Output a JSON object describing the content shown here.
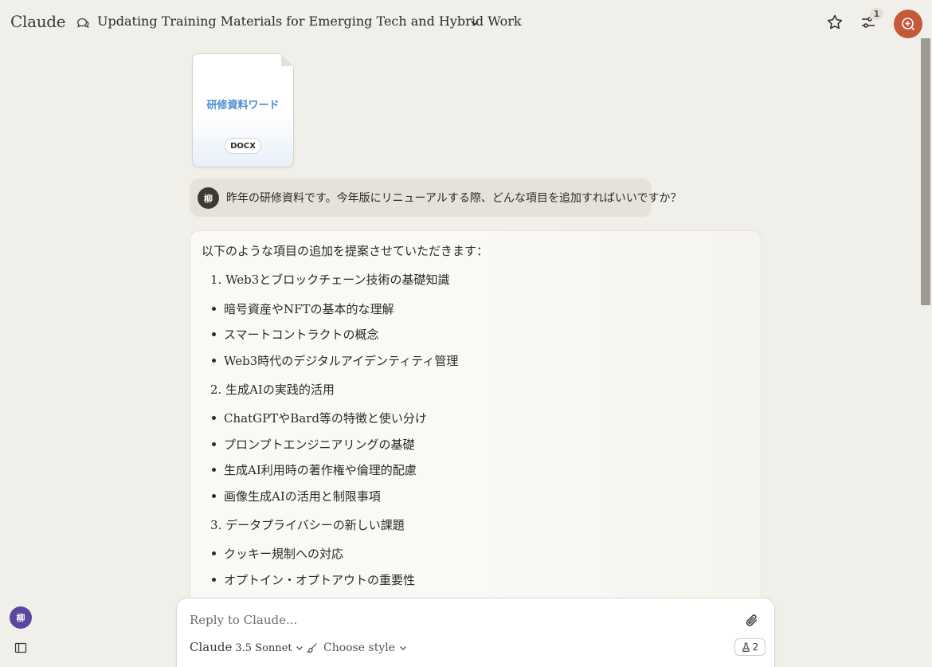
{
  "app": {
    "name": "Claude"
  },
  "header": {
    "chat_title": "Updating Training Materials for Emerging Tech and Hybrid Work",
    "settings_badge": "1"
  },
  "attachment": {
    "name": "研修資料ワード",
    "type": "DOCX"
  },
  "user_message": {
    "avatar_initial": "柳",
    "text": "昨年の研修資料です。今年版にリニューアルする際、どんな項目を追加すればいいですか？"
  },
  "assistant_message": {
    "intro": "以下のような項目の追加を提案させていただきます：",
    "lines": [
      {
        "kind": "numbered",
        "text": "1. Web3とブロックチェーン技術の基礎知識"
      },
      {
        "kind": "bullet",
        "text": "暗号資産やNFTの基本的な理解"
      },
      {
        "kind": "bullet",
        "text": "スマートコントラクトの概念"
      },
      {
        "kind": "bullet",
        "text": "Web3時代のデジタルアイデンティティ管理"
      },
      {
        "kind": "numbered",
        "text": "2. 生成AIの実践的活用"
      },
      {
        "kind": "bullet",
        "text": "ChatGPTやBard等の特徴と使い分け"
      },
      {
        "kind": "bullet",
        "text": "プロンプトエンジニアリングの基礎"
      },
      {
        "kind": "bullet",
        "text": "生成AI利用時の著作権や倫理的配慮"
      },
      {
        "kind": "bullet",
        "text": "画像生成AIの活用と制限事項"
      },
      {
        "kind": "numbered",
        "text": "3. データプライバシーの新しい課題"
      },
      {
        "kind": "bullet",
        "text": "クッキー規制への対応"
      },
      {
        "kind": "bullet",
        "text": "オプトイン・オプトアウトの重要性"
      }
    ]
  },
  "composer": {
    "placeholder": "Reply to Claude...",
    "model_name": "Claude",
    "model_version": "3.5 Sonnet",
    "style_label": "Choose style",
    "features_count": "2"
  },
  "sidebar": {
    "avatar_initial": "柳"
  },
  "colors": {
    "background": "#f1efe9",
    "accent": "#c4593b",
    "doc_title": "#4a8fd1",
    "sidebar_avatar": "#5a47a0"
  },
  "icons": [
    "chat-bubbles-icon",
    "chevron-down-icon",
    "star-icon",
    "sliders-icon",
    "new-chat-icon",
    "paperclip-icon",
    "brush-icon",
    "flask-icon",
    "sidebar-toggle-icon"
  ]
}
